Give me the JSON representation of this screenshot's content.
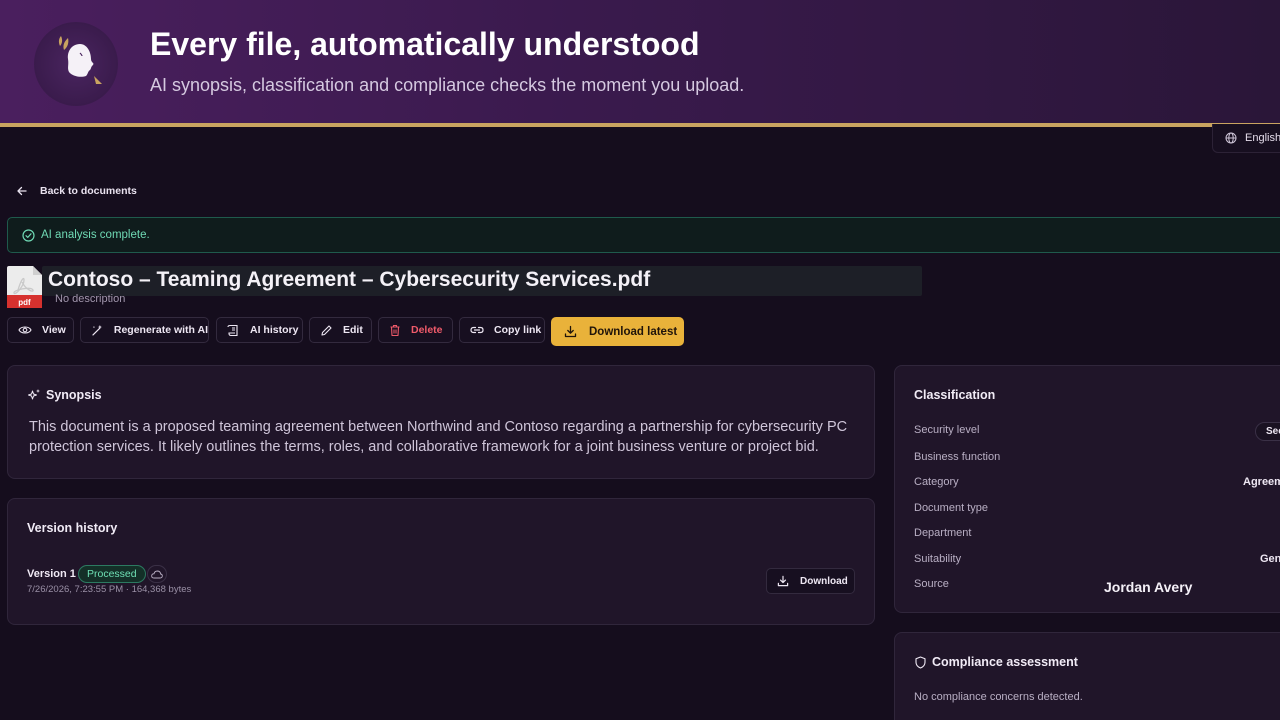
{
  "banner": {
    "title": "Every file, automatically understood",
    "subtitle": "AI synopsis, classification and compliance checks the moment you upload."
  },
  "language": {
    "label": "English",
    "icon": "globe-icon"
  },
  "nav": {
    "back_label": "Back to documents",
    "icon": "arrow-left-icon"
  },
  "alert": {
    "text": "AI analysis complete.",
    "icon": "check-circle-icon"
  },
  "document": {
    "title": "Contoso – Teaming Agreement – Cybersecurity Services.pdf",
    "description": "No description",
    "file_type": "pdf"
  },
  "toolbar": {
    "view": "View",
    "regenerate": "Regenerate with AI",
    "history": "AI history",
    "edit": "Edit",
    "delete": "Delete",
    "copy_link": "Copy link",
    "download_latest": "Download latest"
  },
  "synopsis": {
    "heading": "Synopsis",
    "text": "This document is a proposed teaming agreement between Northwind and Contoso regarding a partnership for cybersecurity PC protection services. It likely outlines the terms, roles, and collaborative framework for a joint business venture or project bid."
  },
  "versions": {
    "heading": "Version history",
    "items": [
      {
        "label": "Version 1",
        "status": "Processed",
        "meta": "7/26/2026, 7:23:55 PM · 164,368 bytes",
        "download_label": "Download"
      }
    ]
  },
  "classification": {
    "heading": "Classification",
    "rows": [
      {
        "label": "Security level",
        "value": "Sec"
      },
      {
        "label": "Business function",
        "value": ""
      },
      {
        "label": "Category",
        "value": "Agreem"
      },
      {
        "label": "Document type",
        "value": ""
      },
      {
        "label": "Department",
        "value": ""
      },
      {
        "label": "Suitability",
        "value": "Gen"
      },
      {
        "label": "Source",
        "value": "Jordan Avery"
      }
    ]
  },
  "compliance": {
    "heading": "Compliance assessment",
    "text": "No compliance concerns detected."
  },
  "colors": {
    "accent": "#e9b23a",
    "banner_rule": "#c9a460",
    "success": "#6fd9b4",
    "danger": "#ef5a6a",
    "background": "#150d1d"
  }
}
